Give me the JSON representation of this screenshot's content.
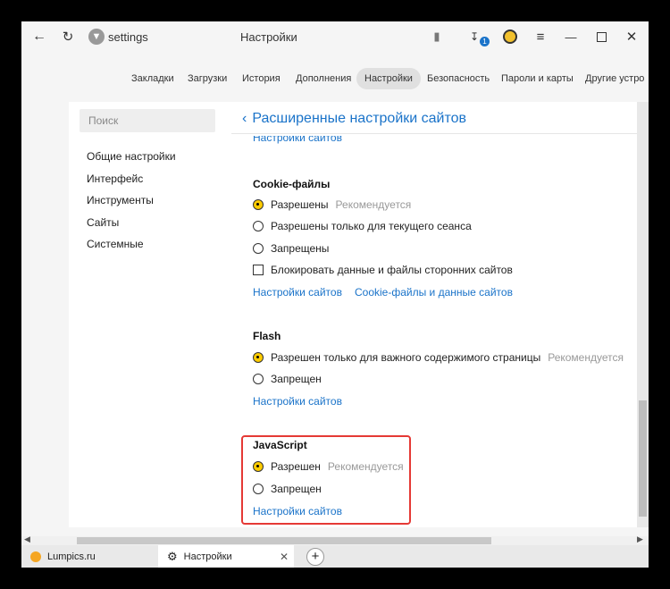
{
  "titlebar": {
    "address": "settings",
    "page_title": "Настройки",
    "download_badge": "1"
  },
  "nav_tabs": [
    {
      "label": "Закладки",
      "active": false
    },
    {
      "label": "Загрузки",
      "active": false
    },
    {
      "label": "История",
      "active": false
    },
    {
      "label": "Дополнения",
      "active": false
    },
    {
      "label": "Настройки",
      "active": true
    },
    {
      "label": "Безопасность",
      "active": false
    },
    {
      "label": "Пароли и карты",
      "active": false
    },
    {
      "label": "Другие устро",
      "active": false
    }
  ],
  "sidebar": {
    "search_placeholder": "Поиск",
    "items": [
      "Общие настройки",
      "Интерфейс",
      "Инструменты",
      "Сайты",
      "Системные"
    ]
  },
  "content": {
    "back_title": "Расширенные настройки сайтов",
    "cut_link": "Настройки сайтов",
    "cookies": {
      "heading": "Cookie-файлы",
      "options": [
        {
          "label": "Разрешены",
          "hint": "Рекомендуется",
          "selected": true
        },
        {
          "label": "Разрешены только для текущего сеанса",
          "hint": "",
          "selected": false
        },
        {
          "label": "Запрещены",
          "hint": "",
          "selected": false
        }
      ],
      "checkbox_label": "Блокировать данные и файлы сторонних сайтов",
      "checkbox_checked": false,
      "link1": "Настройки сайтов",
      "link2": "Cookie-файлы и данные сайтов"
    },
    "flash": {
      "heading": "Flash",
      "options": [
        {
          "label": "Разрешен только для важного содержимого страницы",
          "hint": "Рекомендуется",
          "selected": true
        },
        {
          "label": "Запрещен",
          "hint": "",
          "selected": false
        }
      ],
      "link": "Настройки сайтов"
    },
    "javascript": {
      "heading": "JavaScript",
      "options": [
        {
          "label": "Разрешен",
          "hint": "Рекомендуется",
          "selected": true
        },
        {
          "label": "Запрещен",
          "hint": "",
          "selected": false
        }
      ],
      "link": "Настройки сайтов"
    }
  },
  "bottom_tabs": [
    {
      "label": "Lumpics.ru"
    },
    {
      "label": "Настройки"
    }
  ],
  "colors": {
    "accent": "#1a73c9",
    "radio_selected": "#ffcc00",
    "highlight": "#e53935"
  }
}
